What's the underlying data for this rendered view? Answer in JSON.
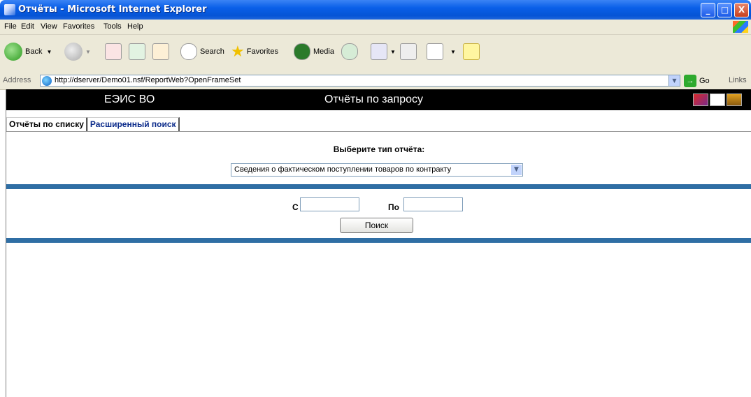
{
  "window": {
    "title": "Отчёты - Microsoft Internet Explorer",
    "buttons": {
      "minimize": "_",
      "maximize": "□",
      "close": "X"
    }
  },
  "menu": [
    "File",
    "Edit",
    "View",
    "Favorites",
    "Tools",
    "Help"
  ],
  "toolbar": {
    "back": "Back",
    "search": "Search",
    "favorites": "Favorites",
    "media": "Media"
  },
  "address": {
    "label": "Address",
    "url": "http://dserver/Demo01.nsf/ReportWeb?OpenFrameSet",
    "go": "Go",
    "links": "Links"
  },
  "header": {
    "app_name": "ЕЭИС ВО",
    "page_title": "Отчёты по запросу"
  },
  "tabs": [
    {
      "label": "Отчёты по списку",
      "active": true
    },
    {
      "label": "Расширенный поиск",
      "active": false
    }
  ],
  "report": {
    "label": "Выберите тип отчёта:",
    "selected": "Сведения о фактическом поступлении товаров по контракту"
  },
  "dates": {
    "from_label": "С",
    "to_label": "По",
    "from_value": "",
    "to_value": ""
  },
  "search_button": "Поиск",
  "colors": {
    "divider": "#2f6ea4",
    "header_bg": "#000000",
    "tab_link": "#0a2a8a"
  }
}
